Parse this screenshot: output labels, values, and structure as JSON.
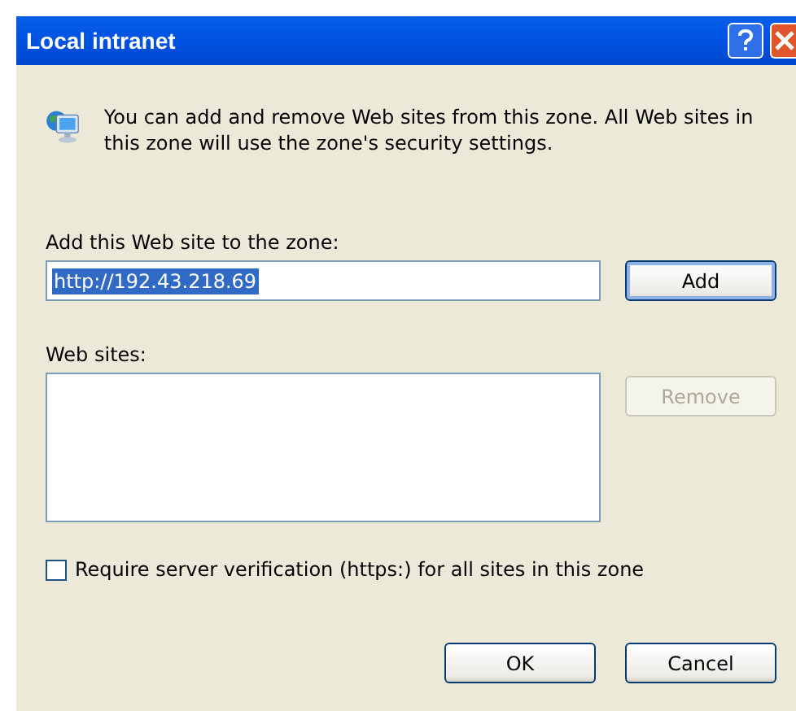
{
  "window": {
    "title": "Local intranet"
  },
  "description": "You can add and remove Web sites from this zone. All Web sites in this zone will use the zone's security settings.",
  "add_field": {
    "label": "Add this Web site to the zone:",
    "value": "http://192.43.218.69",
    "value_highlighted": true
  },
  "websites": {
    "label": "Web sites:"
  },
  "side_buttons": [
    {
      "label": "Add",
      "disabled": false,
      "default": true
    },
    {
      "label": "Remove",
      "disabled": true,
      "default": false
    }
  ],
  "checkbox": {
    "label": "Require server verification (https:) for all sites in this zone",
    "checked": false
  },
  "buttons": [
    {
      "label": "OK",
      "disabled": false,
      "default": false
    },
    {
      "label": "Cancel",
      "disabled": false,
      "default": false
    }
  ]
}
